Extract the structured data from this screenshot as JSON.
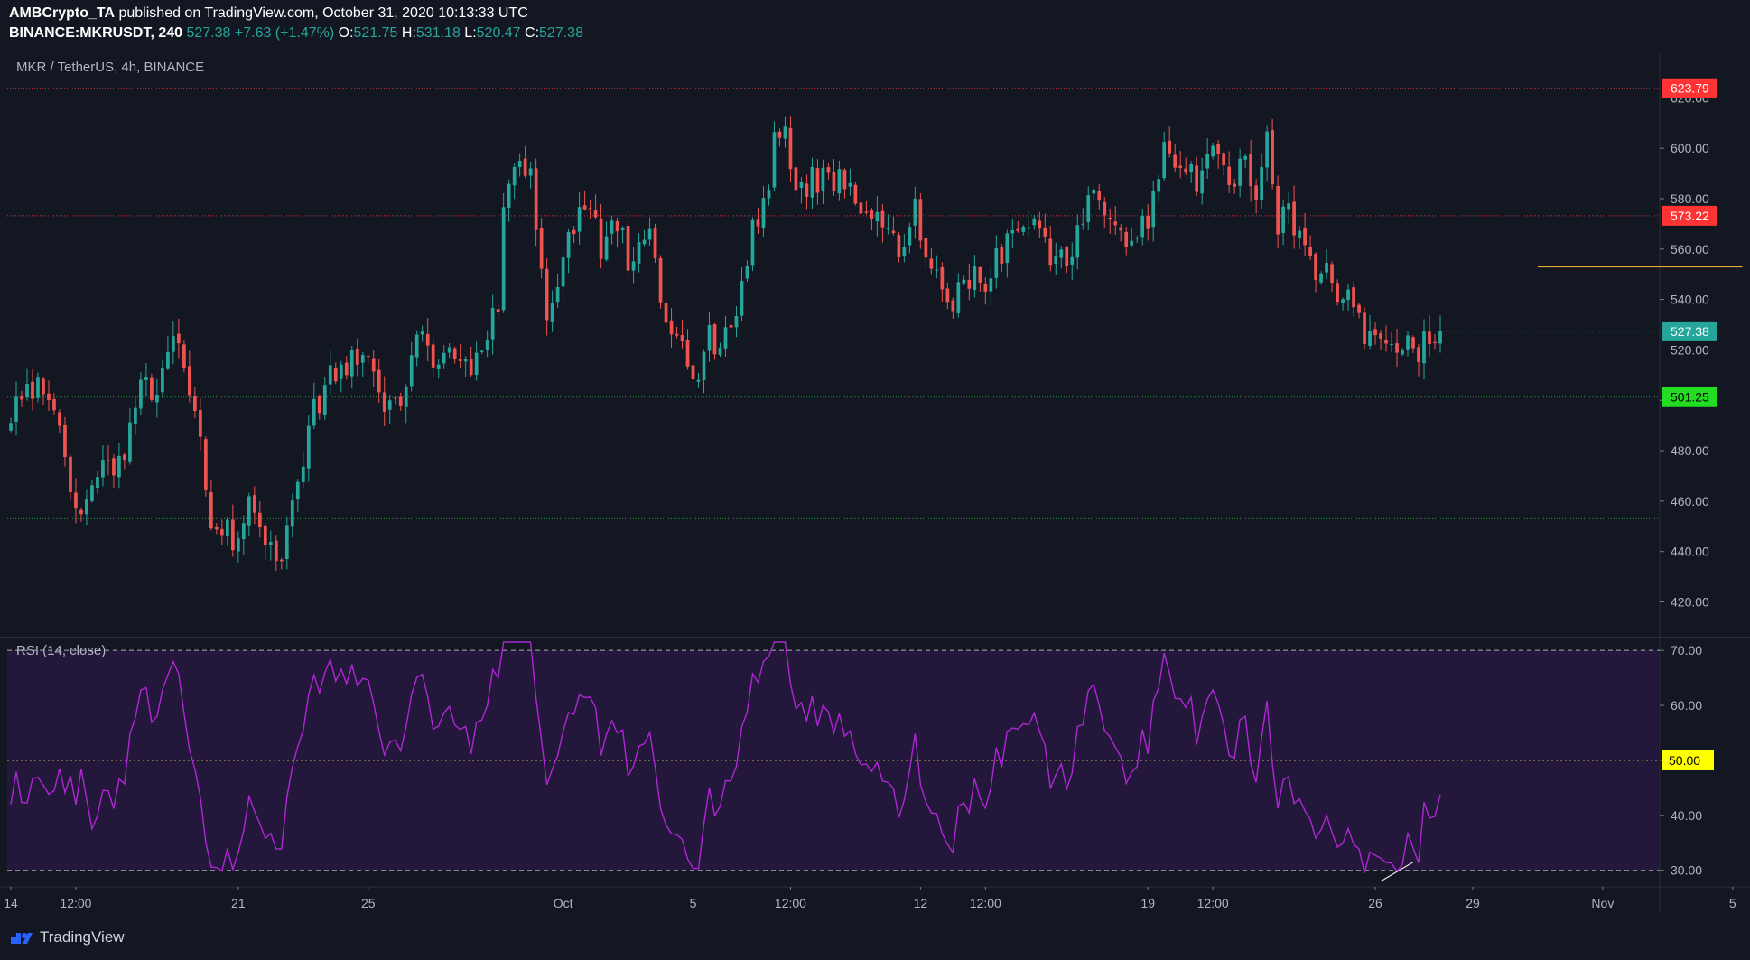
{
  "header": {
    "publisher": "AMBCrypto_TA",
    "published_text": "published on TradingView.com, October 31, 2020 10:13:33 UTC",
    "symbol": "BINANCE:MKRUSDT, 240",
    "last": "527.38",
    "change": "+7.63 (+1.47%)",
    "o_label": "O:",
    "o_value": "521.75",
    "h_label": "H:",
    "h_value": "531.18",
    "l_label": "L:",
    "l_value": "520.47",
    "c_label": "C:",
    "c_value": "527.38"
  },
  "footer": {
    "brand": "TradingView"
  },
  "colors": {
    "background": "#131722",
    "up": "#26a69a",
    "down": "#ef5350",
    "rsi_line": "#b026d4",
    "rsi_band": "#2a1a45",
    "resistance": "#ff3333",
    "support": "#22bb44",
    "target": "#e8a33a"
  },
  "chart_data": [
    {
      "type": "candlestick",
      "title": "MKR / TetherUS, 4h, BINANCE",
      "ylim": [
        408,
        628
      ],
      "y_ticks": [
        "620.00",
        "600.00",
        "580.00",
        "560.00",
        "540.00",
        "520.00",
        "500.00",
        "480.00",
        "460.00",
        "440.00",
        "420.00"
      ],
      "x_ticks": [
        "14",
        "12:00",
        "21",
        "25",
        "Oct",
        "5",
        "12:00",
        "12",
        "12:00",
        "19",
        "12:00",
        "26",
        "29",
        "Nov",
        "5"
      ],
      "levels": [
        {
          "label": "623.79",
          "value": 623.79,
          "style": "resistance"
        },
        {
          "label": "573.22",
          "value": 573.22,
          "style": "resistance"
        },
        {
          "label": "501.25",
          "value": 501.25,
          "style": "support"
        },
        {
          "value": 453.0,
          "style": "support"
        }
      ],
      "last_price": {
        "label": "527.38",
        "value": 527.38
      },
      "target_line": {
        "value": 553,
        "from": "Oct 31",
        "to": "Nov 7"
      },
      "trend_line": {
        "from": [
          519.5,
          522
        ],
        "to": [
          526.5,
          513
        ]
      },
      "anchors": [
        [
          0,
          494
        ],
        [
          5,
          505
        ],
        [
          9,
          488
        ],
        [
          12,
          457
        ],
        [
          16,
          470
        ],
        [
          20,
          472
        ],
        [
          24,
          505
        ],
        [
          27,
          500
        ],
        [
          30,
          526
        ],
        [
          33,
          505
        ],
        [
          37,
          455
        ],
        [
          41,
          445
        ],
        [
          44,
          460
        ],
        [
          46,
          452
        ],
        [
          50,
          436
        ],
        [
          52,
          460
        ],
        [
          56,
          497
        ],
        [
          60,
          512
        ],
        [
          65,
          518
        ],
        [
          68,
          500
        ],
        [
          72,
          496
        ],
        [
          76,
          532
        ],
        [
          78,
          518
        ],
        [
          82,
          518
        ],
        [
          85,
          509
        ],
        [
          90,
          538
        ],
        [
          91,
          582
        ],
        [
          93,
          594
        ],
        [
          96,
          586
        ],
        [
          99,
          532
        ],
        [
          103,
          562
        ],
        [
          106,
          578
        ],
        [
          109,
          562
        ],
        [
          112,
          572
        ],
        [
          114,
          556
        ],
        [
          118,
          566
        ],
        [
          121,
          525
        ],
        [
          124,
          519
        ],
        [
          127,
          504
        ],
        [
          129,
          526
        ],
        [
          131,
          522
        ],
        [
          134,
          536
        ],
        [
          137,
          566
        ],
        [
          140,
          588
        ],
        [
          141,
          601
        ],
        [
          143,
          607
        ],
        [
          145,
          586
        ],
        [
          149,
          587
        ],
        [
          153,
          586
        ],
        [
          157,
          578
        ],
        [
          160,
          570
        ],
        [
          164,
          560
        ],
        [
          167,
          575
        ],
        [
          170,
          556
        ],
        [
          173,
          536
        ],
        [
          176,
          550
        ],
        [
          180,
          549
        ],
        [
          183,
          559
        ],
        [
          186,
          571
        ],
        [
          189,
          570
        ],
        [
          192,
          558
        ],
        [
          195,
          555
        ],
        [
          198,
          574
        ],
        [
          201,
          582
        ],
        [
          204,
          572
        ],
        [
          207,
          562
        ],
        [
          210,
          571
        ],
        [
          213,
          600
        ],
        [
          216,
          596
        ],
        [
          219,
          588
        ],
        [
          222,
          596
        ],
        [
          225,
          584
        ],
        [
          228,
          596
        ],
        [
          230,
          575
        ],
        [
          232,
          601
        ],
        [
          234,
          568
        ],
        [
          236,
          576
        ],
        [
          239,
          556
        ],
        [
          242,
          552
        ],
        [
          245,
          543
        ],
        [
          247,
          540
        ],
        [
          250,
          525
        ],
        [
          253,
          527
        ],
        [
          256,
          521
        ],
        [
          260,
          520
        ],
        [
          263,
          527
        ]
      ],
      "rsi": {
        "title": "RSI (14, close)",
        "ylim": [
          27,
          72
        ],
        "y_ticks": [
          "70.00",
          "60.00",
          "50.00",
          "40.00",
          "30.00"
        ],
        "levels": [
          {
            "value": 70,
            "style": "band"
          },
          {
            "label": "50.00",
            "value": 50,
            "style": "mid"
          },
          {
            "value": 30,
            "style": "band"
          }
        ],
        "trend_line": {
          "from": [
            253,
            28
          ],
          "to": [
            259,
            31.5
          ]
        }
      }
    }
  ]
}
